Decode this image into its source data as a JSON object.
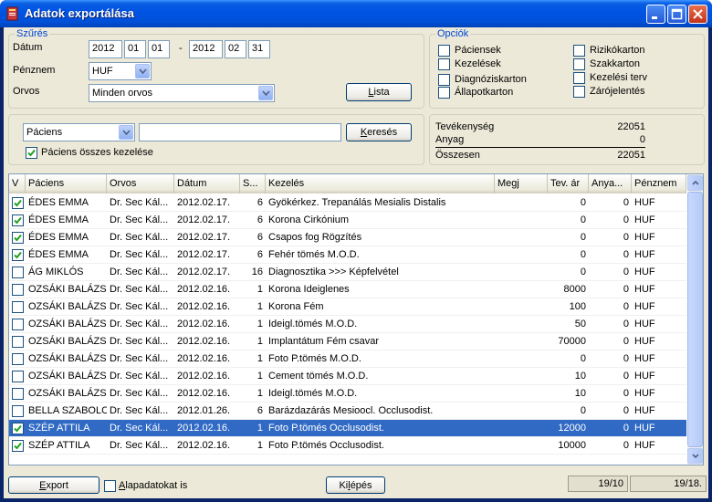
{
  "window": {
    "title": "Adatok exportálása"
  },
  "filter": {
    "legend": "Szűrés",
    "date_label": "Dátum",
    "date_from": {
      "year": "2012",
      "month": "01",
      "day": "01"
    },
    "date_sep": "-",
    "date_to": {
      "year": "2012",
      "month": "02",
      "day": "31"
    },
    "currency_label": "Pénznem",
    "currency_value": "HUF",
    "doctor_label": "Orvos",
    "doctor_value": "Minden orvos",
    "list_button": "Lista"
  },
  "options": {
    "legend": "Opciók",
    "items": [
      {
        "label": "Páciensek",
        "checked": false
      },
      {
        "label": "Kezelések",
        "checked": false
      },
      {
        "label": "Diagnóziskarton",
        "checked": false
      },
      {
        "label": "Állapotkarton",
        "checked": false
      },
      {
        "label": "Rizikókarton",
        "checked": false
      },
      {
        "label": "Szakkarton",
        "checked": false
      },
      {
        "label": "Kezelési terv",
        "checked": false
      },
      {
        "label": "Zárójelentés",
        "checked": false
      }
    ]
  },
  "search": {
    "field_value": "Páciens",
    "query": "",
    "button": "Keresés",
    "all_treatments_label": "Páciens összes kezelése",
    "all_treatments_checked": true
  },
  "summary": {
    "activity_label": "Tevékenység",
    "activity_value": "22051",
    "material_label": "Anyag",
    "material_value": "0",
    "total_label": "Összesen",
    "total_value": "22051"
  },
  "grid": {
    "columns": [
      "V",
      "Páciens",
      "Orvos",
      "Dátum",
      "S...",
      "Kezelés",
      "Megj",
      "Tev. ár",
      "Anya...",
      "Pénznem"
    ],
    "rows": [
      {
        "checked": true,
        "patient": "ÉDES EMMA",
        "doctor": "Dr. Sec Kál...",
        "date": "2012.02.17.",
        "s": "6",
        "treatment": "Gyökérkez. Trepanálás Mesialis Distalis",
        "note": "",
        "price": "0",
        "material": "0",
        "currency": "HUF",
        "selected": false
      },
      {
        "checked": true,
        "patient": "ÉDES EMMA",
        "doctor": "Dr. Sec Kál...",
        "date": "2012.02.17.",
        "s": "6",
        "treatment": "Korona Cirkónium",
        "note": "",
        "price": "0",
        "material": "0",
        "currency": "HUF",
        "selected": false
      },
      {
        "checked": true,
        "patient": "ÉDES EMMA",
        "doctor": "Dr. Sec Kál...",
        "date": "2012.02.17.",
        "s": "6",
        "treatment": "Csapos fog Rögzítés",
        "note": "",
        "price": "0",
        "material": "0",
        "currency": "HUF",
        "selected": false
      },
      {
        "checked": true,
        "patient": "ÉDES EMMA",
        "doctor": "Dr. Sec Kál...",
        "date": "2012.02.17.",
        "s": "6",
        "treatment": "Fehér tömés M.O.D.",
        "note": "",
        "price": "0",
        "material": "0",
        "currency": "HUF",
        "selected": false
      },
      {
        "checked": false,
        "patient": "ÁG MIKLÓS",
        "doctor": "Dr. Sec Kál...",
        "date": "2012.02.17.",
        "s": "16",
        "treatment": "Diagnosztika >>> Képfelvétel",
        "note": "",
        "price": "0",
        "material": "0",
        "currency": "HUF",
        "selected": false
      },
      {
        "checked": false,
        "patient": "OZSÁKI BALÁZS",
        "doctor": "Dr. Sec Kál...",
        "date": "2012.02.16.",
        "s": "1",
        "treatment": "Korona Ideiglenes",
        "note": "",
        "price": "8000",
        "material": "0",
        "currency": "HUF",
        "selected": false
      },
      {
        "checked": false,
        "patient": "OZSÁKI BALÁZS",
        "doctor": "Dr. Sec Kál...",
        "date": "2012.02.16.",
        "s": "1",
        "treatment": "Korona Fém",
        "note": "",
        "price": "100",
        "material": "0",
        "currency": "HUF",
        "selected": false
      },
      {
        "checked": false,
        "patient": "OZSÁKI BALÁZS",
        "doctor": "Dr. Sec Kál...",
        "date": "2012.02.16.",
        "s": "1",
        "treatment": "Ideigl.tömés M.O.D.",
        "note": "",
        "price": "50",
        "material": "0",
        "currency": "HUF",
        "selected": false
      },
      {
        "checked": false,
        "patient": "OZSÁKI BALÁZS",
        "doctor": "Dr. Sec Kál...",
        "date": "2012.02.16.",
        "s": "1",
        "treatment": "Implantátum Fém csavar",
        "note": "",
        "price": "70000",
        "material": "0",
        "currency": "HUF",
        "selected": false
      },
      {
        "checked": false,
        "patient": "OZSÁKI BALÁZS",
        "doctor": "Dr. Sec Kál...",
        "date": "2012.02.16.",
        "s": "1",
        "treatment": "Foto P.tömés M.O.D.",
        "note": "",
        "price": "0",
        "material": "0",
        "currency": "HUF",
        "selected": false
      },
      {
        "checked": false,
        "patient": "OZSÁKI BALÁZS",
        "doctor": "Dr. Sec Kál...",
        "date": "2012.02.16.",
        "s": "1",
        "treatment": "Cement tömés M.O.D.",
        "note": "",
        "price": "10",
        "material": "0",
        "currency": "HUF",
        "selected": false
      },
      {
        "checked": false,
        "patient": "OZSÁKI BALÁZS",
        "doctor": "Dr. Sec Kál...",
        "date": "2012.02.16.",
        "s": "1",
        "treatment": "Ideigl.tömés M.O.D.",
        "note": "",
        "price": "10",
        "material": "0",
        "currency": "HUF",
        "selected": false
      },
      {
        "checked": false,
        "patient": "BELLA SZABOLCS",
        "doctor": "Dr. Sec Kál...",
        "date": "2012.01.26.",
        "s": "6",
        "treatment": "Barázdazárás Mesioocl. Occlusodist.",
        "note": "",
        "price": "0",
        "material": "0",
        "currency": "HUF",
        "selected": false
      },
      {
        "checked": true,
        "patient": "SZÉP ATTILA",
        "doctor": "Dr. Sec Kál...",
        "date": "2012.02.16.",
        "s": "1",
        "treatment": "Foto P.tömés Occlusodist.",
        "note": "",
        "price": "12000",
        "material": "0",
        "currency": "HUF",
        "selected": true
      },
      {
        "checked": true,
        "patient": "SZÉP ATTILA",
        "doctor": "Dr. Sec Kál...",
        "date": "2012.02.16.",
        "s": "1",
        "treatment": "Foto P.tömés Occlusodist.",
        "note": "",
        "price": "10000",
        "material": "0",
        "currency": "HUF",
        "selected": false
      }
    ]
  },
  "footer": {
    "export_button": "Export",
    "base_data_label": "Alapadatokat is",
    "base_data_checked": false,
    "exit_button": "Kilépés",
    "status_left": "19/10",
    "status_right": "19/18."
  },
  "colors": {
    "accent": "#0046d5",
    "selection": "#316ac5",
    "titlebar": "#0054e3",
    "face": "#ece9d8"
  }
}
